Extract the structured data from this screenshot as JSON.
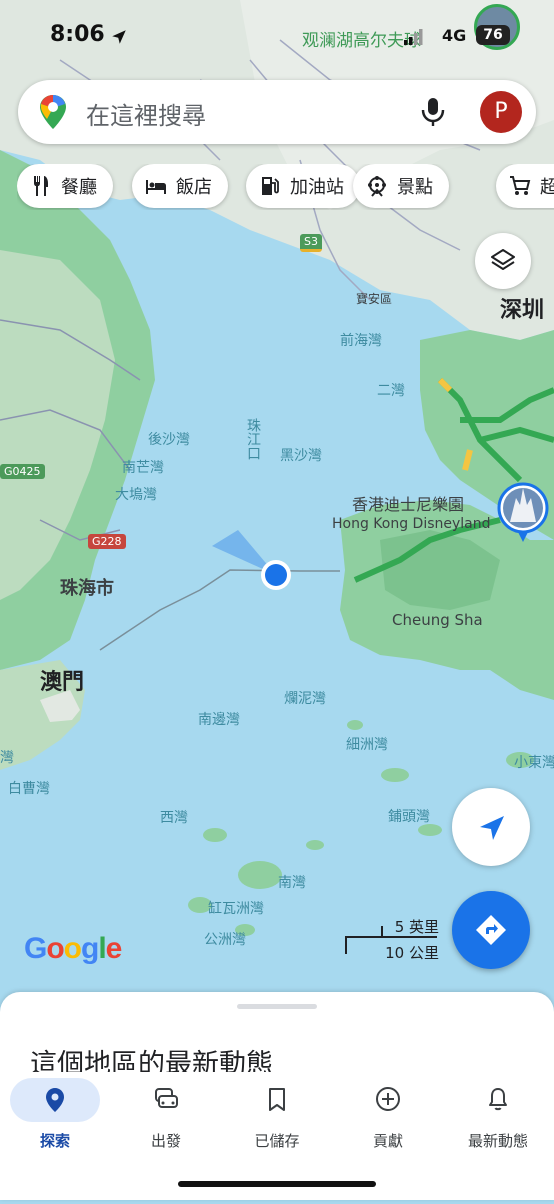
{
  "status_bar": {
    "time": "8:06",
    "network": "4G",
    "battery": "76",
    "map_label": "观澜湖高尔夫球"
  },
  "search": {
    "placeholder": "在這裡搜尋",
    "avatar_letter": "P"
  },
  "chips": [
    {
      "label": "餐廳",
      "icon": "restaurant-icon"
    },
    {
      "label": "飯店",
      "icon": "hotel-icon"
    },
    {
      "label": "加油站",
      "icon": "gas-station-icon"
    },
    {
      "label": "景點",
      "icon": "attractions-icon"
    },
    {
      "label": "超",
      "icon": "shopping-cart-icon"
    }
  ],
  "map": {
    "labels": {
      "shenzhen": "深圳",
      "baoan": "寶安區",
      "qianhaiwan": "前海灣",
      "erwan": "二灣",
      "housha": "後沙灣",
      "zhujiangkou": "珠江口",
      "heisha": "黑沙灣",
      "nanmang": "南芒灣",
      "dawu": "大塢灣",
      "zhuhai": "珠海市",
      "macau": "澳門",
      "disney_zh": "香港迪士尼樂園",
      "disney_en": "Hong Kong Disneyland",
      "cheungsha": "Cheung Sha",
      "lanni": "爛泥灣",
      "nanbian": "南邊灣",
      "xizhou": "細洲灣",
      "xiaodong": "小東灣",
      "baicao": "白曹灣",
      "xiwan": "西灣",
      "putou": "鋪頭灣",
      "nanwan": "南灣",
      "gangwa": "缸瓦洲灣",
      "gongzhou": "公洲灣",
      "left_edge_wan": "灣"
    },
    "road_badges": {
      "s3": "S3",
      "g0425": "G0425",
      "g228": "G228"
    },
    "colors": {
      "water": "#a7d9ef",
      "land": "#8fcfa0",
      "urban": "#dfe7e0",
      "location_dot": "#1a73e8",
      "traffic_green": "#34a853",
      "traffic_yellow": "#f4c542"
    }
  },
  "scale": {
    "imperial": "5 英里",
    "metric": "10 公里"
  },
  "google_logo": "Google",
  "sheet": {
    "title": "這個地區的最新動態"
  },
  "tabs": [
    {
      "label": "探索",
      "icon": "location-pin-icon",
      "active": true
    },
    {
      "label": "出發",
      "icon": "car-icon",
      "active": false
    },
    {
      "label": "已儲存",
      "icon": "bookmark-icon",
      "active": false
    },
    {
      "label": "貢獻",
      "icon": "add-circle-icon",
      "active": false
    },
    {
      "label": "最新動態",
      "icon": "bell-icon",
      "active": false
    }
  ]
}
